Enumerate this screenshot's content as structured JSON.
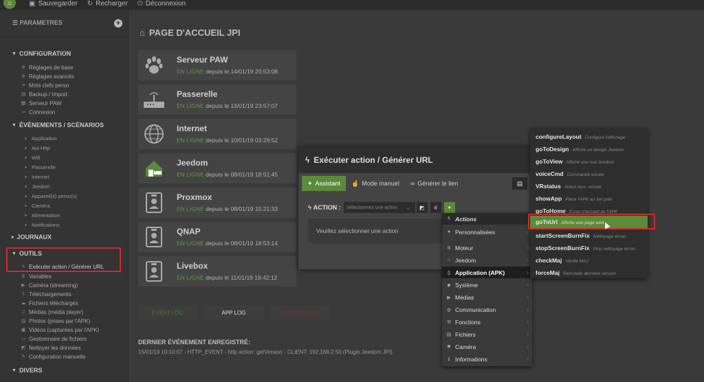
{
  "topbar": {
    "save": "Sauvegarder",
    "reload": "Recharger",
    "logout": "Déconnexion"
  },
  "sidebar": {
    "header": "PARAMETRES",
    "configuration": {
      "title": "CONFIGURATION",
      "items": [
        "Réglages de base",
        "Réglages avancés",
        "Mots clefs perso",
        "Backup / Import",
        "Serveur PAW",
        "Connexion"
      ]
    },
    "events": {
      "title": "ÉVÉNEMENTS / SCÉNARIOS",
      "items": [
        "Application",
        "Api Http",
        "Wifi",
        "Passerelle",
        "Internet",
        "Jeedom",
        "Appareil(s) perso(s)",
        "Caméra",
        "Alimentation",
        "Notifications"
      ]
    },
    "journaux": {
      "title": "JOURNAUX"
    },
    "outils": {
      "title": "OUTILS",
      "items": [
        "Exécuter action / Générer URL",
        "Variables",
        "Caméra (streaming)",
        "Téléchargements",
        "Fichiers téléchargés",
        "Médias (média player)",
        "Photos (prises par l'APK)",
        "Vidéos (capturées par l'APK)",
        "Gestionnaire de fichiers",
        "Nettoyer les données",
        "Configuration manuelle"
      ]
    },
    "divers": {
      "title": "DIVERS"
    }
  },
  "main": {
    "title": "PAGE D'ACCUEIL JPI",
    "online_label": "EN LIGNE",
    "cards": [
      {
        "name": "Serveur PAW",
        "since": "depuis le 14/01/19 20:53:08"
      },
      {
        "name": "Passerelle",
        "since": "depuis le 13/01/19 23:57:07"
      },
      {
        "name": "Internet",
        "since": "depuis le 10/01/19 03:29:52"
      },
      {
        "name": "Jeedom",
        "since": "depuis le 08/01/19 18:51:45"
      },
      {
        "name": "Proxmox",
        "since": "depuis le 08/01/19 15:21:33"
      },
      {
        "name": "QNAP",
        "since": "depuis le 08/01/19 18:53:14"
      },
      {
        "name": "Livebox",
        "since": "depuis le 11/01/19 19:42:12"
      }
    ],
    "logs": {
      "event_log": "EVENT LOG",
      "app_log": "APP LOG",
      "error_log": "ERROR LOG"
    },
    "last_event_title": "DERNIER ÉVÉNEMENT ENREGISTRÉ:",
    "last_event": "15/01/19 10:10:07 - HTTP_EVENT - http action: getVersion - CLIENT: 192.168.2.50 (Plugin Jeedom JPI)"
  },
  "modal": {
    "title": "Exécuter action / Générer URL",
    "tabs": [
      "Assistant",
      "Mode manuel",
      "Générer le lien"
    ],
    "action_label": "ACTION :",
    "select_placeholder": "Sélectionnez une action",
    "hash": "#",
    "empty_message": "Veuillez sélectionner une action"
  },
  "menu": {
    "header": "Actions",
    "items": [
      "Personnalisées",
      "Moteur",
      "Jeedom",
      "Application (APK)",
      "Système",
      "Médias",
      "Communication",
      "Fonctions",
      "Fichiers",
      "Caméra",
      "Informations"
    ]
  },
  "submenu": {
    "items": [
      {
        "cmd": "configureLayout",
        "desc": "Configure l'affichage"
      },
      {
        "cmd": "goToDesign",
        "desc": "Affiche un design Jeedom"
      },
      {
        "cmd": "goToView",
        "desc": "Affiche une vue Jeedom"
      },
      {
        "cmd": "voiceCmd",
        "desc": "Commande vocale"
      },
      {
        "cmd": "VRstatus",
        "desc": "Statut reco. vocale"
      },
      {
        "cmd": "showApp",
        "desc": "Place l'APK au 1er plan"
      },
      {
        "cmd": "goToHome",
        "desc": "Écran d'accueil de l'APK"
      },
      {
        "cmd": "goToUrl",
        "desc": "Affiche une page web"
      },
      {
        "cmd": "startScreenBurnFix",
        "desc": "Nettoyage écran"
      },
      {
        "cmd": "stopScreenBurnFix",
        "desc": "Stop nettoyage écran"
      },
      {
        "cmd": "checkMaj",
        "desc": "Vérifie MAJ"
      },
      {
        "cmd": "forceMaj",
        "desc": "Réinstalle dernière version"
      }
    ]
  },
  "colors": {
    "accent_green": "#5b8a3a",
    "highlight_red": "#d12a2a",
    "online_green": "#5a9a3a",
    "error_red": "#c83a3a"
  }
}
